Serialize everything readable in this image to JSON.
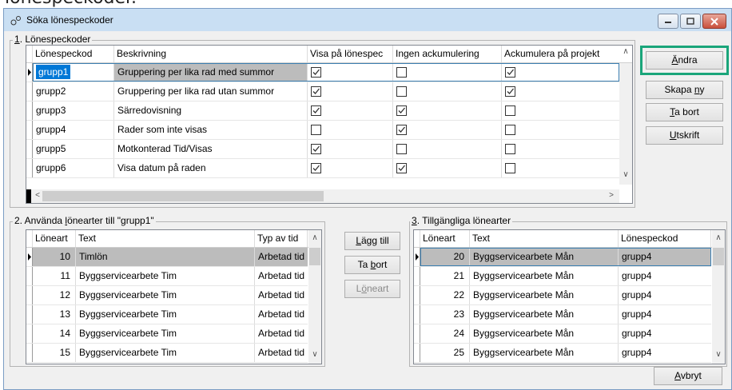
{
  "window": {
    "title": "Söka lönespeckoder",
    "cut_text": "lönespeckoder."
  },
  "group1": {
    "label": "1. Lönespeckoder",
    "columns": [
      "Lönespeckod",
      "Beskrivning",
      "Visa på lönespec",
      "Ingen ackumulering",
      "Ackumulera på projekt"
    ],
    "rows": [
      {
        "kod": "grupp1",
        "besk": "Gruppering per lika rad med summor",
        "visa": true,
        "ingen": false,
        "ack": true
      },
      {
        "kod": "grupp2",
        "besk": "Gruppering per lika rad utan summor",
        "visa": true,
        "ingen": false,
        "ack": true
      },
      {
        "kod": "grupp3",
        "besk": "Särredovisning",
        "visa": true,
        "ingen": true,
        "ack": false
      },
      {
        "kod": "grupp4",
        "besk": "Rader som inte visas",
        "visa": false,
        "ingen": true,
        "ack": false
      },
      {
        "kod": "grupp5",
        "besk": "Motkonterad Tid/Visas",
        "visa": true,
        "ingen": false,
        "ack": false
      },
      {
        "kod": "grupp6",
        "besk": "Visa datum på raden",
        "visa": true,
        "ingen": true,
        "ack": false
      }
    ]
  },
  "side_buttons": {
    "andra": "Ändra",
    "skapa": "Skapa ny",
    "tabort": "Ta bort",
    "utskrift": "Utskrift"
  },
  "group2": {
    "label": "2. Använda lönearter till \"grupp1\"",
    "columns": [
      "Löneart",
      "Text",
      "Typ av tid"
    ],
    "rows": [
      {
        "nr": "10",
        "text": "Timlön",
        "typ": "Arbetad tid"
      },
      {
        "nr": "11",
        "text": "Byggservicearbete Tim",
        "typ": "Arbetad tid"
      },
      {
        "nr": "12",
        "text": "Byggservicearbete Tim",
        "typ": "Arbetad tid"
      },
      {
        "nr": "13",
        "text": "Byggservicearbete Tim",
        "typ": "Arbetad tid"
      },
      {
        "nr": "14",
        "text": "Byggservicearbete Tim",
        "typ": "Arbetad tid"
      },
      {
        "nr": "15",
        "text": "Byggservicearbete Tim",
        "typ": "Arbetad tid"
      }
    ]
  },
  "mid_buttons": {
    "lagg": "Lägg till",
    "tabort": "Ta bort",
    "loneart": "Löneart"
  },
  "group3": {
    "label": "3. Tillgängliga lönearter",
    "columns": [
      "Löneart",
      "Text",
      "Lönespeckod"
    ],
    "rows": [
      {
        "nr": "20",
        "text": "Byggservicearbete Mån",
        "kod": "grupp4"
      },
      {
        "nr": "21",
        "text": "Byggservicearbete Mån",
        "kod": "grupp4"
      },
      {
        "nr": "22",
        "text": "Byggservicearbete Mån",
        "kod": "grupp4"
      },
      {
        "nr": "23",
        "text": "Byggservicearbete Mån",
        "kod": "grupp4"
      },
      {
        "nr": "24",
        "text": "Byggservicearbete Mån",
        "kod": "grupp4"
      },
      {
        "nr": "25",
        "text": "Byggservicearbete Mån",
        "kod": "grupp4"
      }
    ]
  },
  "footer": {
    "avbryt": "Avbryt"
  },
  "colors": {
    "highlight": "#00a676",
    "titlebar": "#c9dff3",
    "selected_row": "#bcbcbc"
  }
}
